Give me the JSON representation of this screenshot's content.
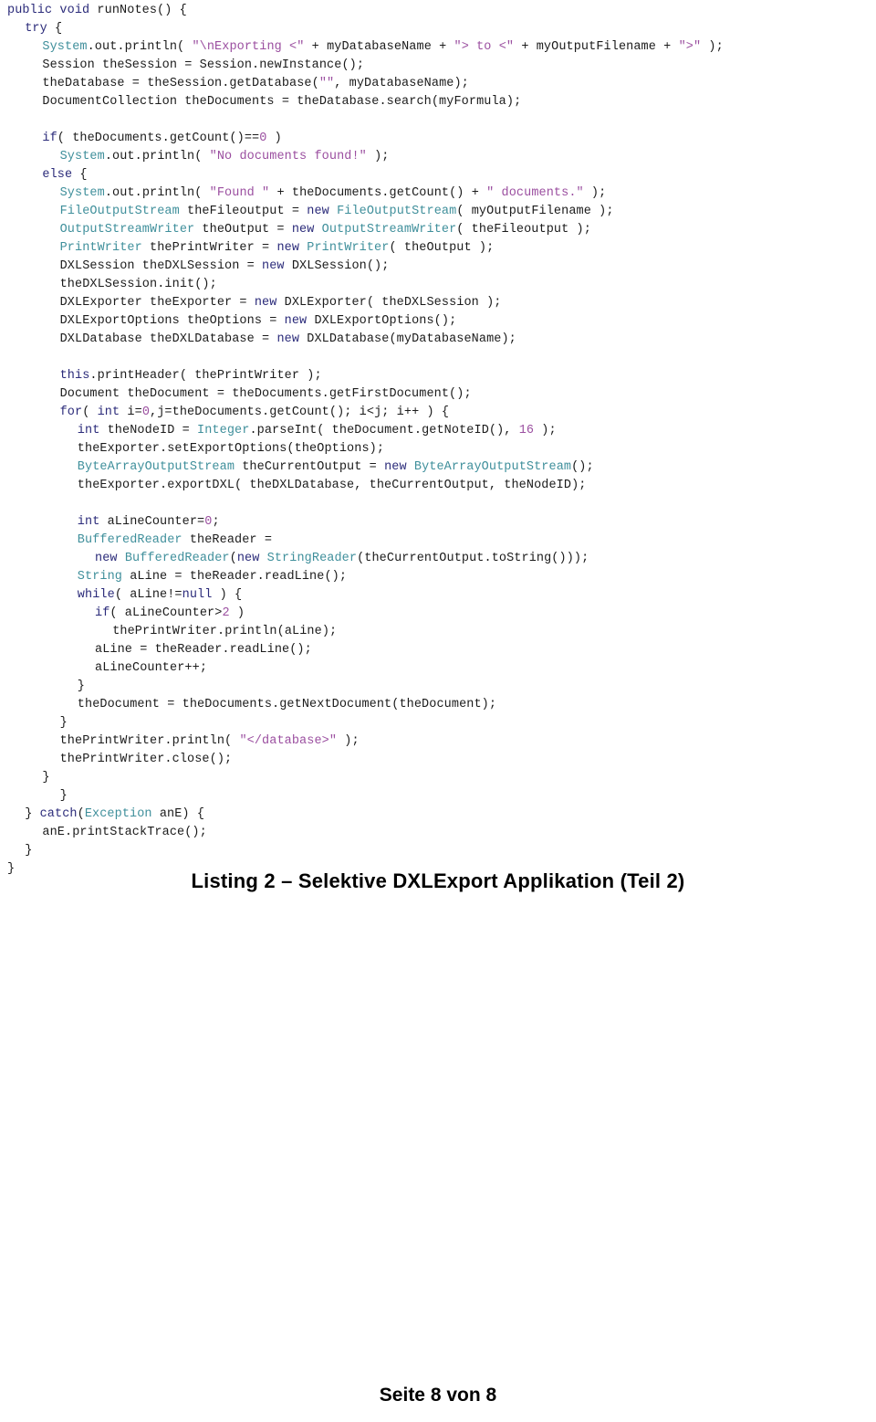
{
  "document": {
    "caption": "Listing 2 – Selektive DXLExport Applikation (Teil 2)",
    "footer": "Seite 8 von 8",
    "language": "java"
  },
  "code": {
    "lines": [
      {
        "indent": 0,
        "tokens": [
          {
            "t": "kw",
            "s": "public"
          },
          {
            "t": "plain",
            "s": " "
          },
          {
            "t": "kw",
            "s": "void"
          },
          {
            "t": "plain",
            "s": " runNotes() {"
          }
        ]
      },
      {
        "indent": 1,
        "tokens": [
          {
            "t": "kw",
            "s": "try"
          },
          {
            "t": "plain",
            "s": " {"
          }
        ]
      },
      {
        "indent": 2,
        "tokens": [
          {
            "t": "type",
            "s": "System"
          },
          {
            "t": "plain",
            "s": ".out.println( "
          },
          {
            "t": "str",
            "s": "\"\\nExporting <\""
          },
          {
            "t": "plain",
            "s": " + myDatabaseName + "
          },
          {
            "t": "str",
            "s": "\"> to <\""
          },
          {
            "t": "plain",
            "s": " + myOutputFilename + "
          },
          {
            "t": "str",
            "s": "\">\""
          },
          {
            "t": "plain",
            "s": " );"
          }
        ]
      },
      {
        "indent": 2,
        "tokens": [
          {
            "t": "plain",
            "s": "Session theSession = Session.newInstance();"
          }
        ]
      },
      {
        "indent": 2,
        "tokens": [
          {
            "t": "plain",
            "s": "theDatabase = theSession.getDatabase("
          },
          {
            "t": "str",
            "s": "\"\""
          },
          {
            "t": "plain",
            "s": ", myDatabaseName);"
          }
        ]
      },
      {
        "indent": 2,
        "tokens": [
          {
            "t": "plain",
            "s": "DocumentCollection theDocuments = theDatabase.search(myFormula);"
          }
        ]
      },
      {
        "indent": 0,
        "tokens": []
      },
      {
        "indent": 2,
        "tokens": [
          {
            "t": "kw",
            "s": "if"
          },
          {
            "t": "plain",
            "s": "( theDocuments.getCount()=="
          },
          {
            "t": "num",
            "s": "0"
          },
          {
            "t": "plain",
            "s": " )"
          }
        ]
      },
      {
        "indent": 3,
        "tokens": [
          {
            "t": "type",
            "s": "System"
          },
          {
            "t": "plain",
            "s": ".out.println( "
          },
          {
            "t": "str",
            "s": "\"No documents found!\""
          },
          {
            "t": "plain",
            "s": " );"
          }
        ]
      },
      {
        "indent": 2,
        "tokens": [
          {
            "t": "kw",
            "s": "else"
          },
          {
            "t": "plain",
            "s": " {"
          }
        ]
      },
      {
        "indent": 3,
        "tokens": [
          {
            "t": "type",
            "s": "System"
          },
          {
            "t": "plain",
            "s": ".out.println( "
          },
          {
            "t": "str",
            "s": "\"Found \""
          },
          {
            "t": "plain",
            "s": " + theDocuments.getCount() + "
          },
          {
            "t": "str",
            "s": "\" documents.\""
          },
          {
            "t": "plain",
            "s": " );"
          }
        ]
      },
      {
        "indent": 3,
        "tokens": [
          {
            "t": "type",
            "s": "FileOutputStream"
          },
          {
            "t": "plain",
            "s": " theFileoutput = "
          },
          {
            "t": "kw",
            "s": "new"
          },
          {
            "t": "plain",
            "s": " "
          },
          {
            "t": "type",
            "s": "FileOutputStream"
          },
          {
            "t": "plain",
            "s": "( myOutputFilename );"
          }
        ]
      },
      {
        "indent": 3,
        "tokens": [
          {
            "t": "type",
            "s": "OutputStreamWriter"
          },
          {
            "t": "plain",
            "s": " theOutput = "
          },
          {
            "t": "kw",
            "s": "new"
          },
          {
            "t": "plain",
            "s": " "
          },
          {
            "t": "type",
            "s": "OutputStreamWriter"
          },
          {
            "t": "plain",
            "s": "( theFileoutput );"
          }
        ]
      },
      {
        "indent": 3,
        "tokens": [
          {
            "t": "type",
            "s": "PrintWriter"
          },
          {
            "t": "plain",
            "s": " thePrintWriter = "
          },
          {
            "t": "kw",
            "s": "new"
          },
          {
            "t": "plain",
            "s": " "
          },
          {
            "t": "type",
            "s": "PrintWriter"
          },
          {
            "t": "plain",
            "s": "( theOutput );"
          }
        ]
      },
      {
        "indent": 3,
        "tokens": [
          {
            "t": "plain",
            "s": "DXLSession theDXLSession = "
          },
          {
            "t": "kw",
            "s": "new"
          },
          {
            "t": "plain",
            "s": " DXLSession();"
          }
        ]
      },
      {
        "indent": 3,
        "tokens": [
          {
            "t": "plain",
            "s": "theDXLSession.init();"
          }
        ]
      },
      {
        "indent": 3,
        "tokens": [
          {
            "t": "plain",
            "s": "DXLExporter theExporter = "
          },
          {
            "t": "kw",
            "s": "new"
          },
          {
            "t": "plain",
            "s": " DXLExporter( theDXLSession );"
          }
        ]
      },
      {
        "indent": 3,
        "tokens": [
          {
            "t": "plain",
            "s": "DXLExportOptions theOptions = "
          },
          {
            "t": "kw",
            "s": "new"
          },
          {
            "t": "plain",
            "s": " DXLExportOptions();"
          }
        ]
      },
      {
        "indent": 3,
        "tokens": [
          {
            "t": "plain",
            "s": "DXLDatabase theDXLDatabase = "
          },
          {
            "t": "kw",
            "s": "new"
          },
          {
            "t": "plain",
            "s": " DXLDatabase(myDatabaseName);"
          }
        ]
      },
      {
        "indent": 0,
        "tokens": []
      },
      {
        "indent": 3,
        "tokens": [
          {
            "t": "kw",
            "s": "this"
          },
          {
            "t": "plain",
            "s": ".printHeader( thePrintWriter );"
          }
        ]
      },
      {
        "indent": 3,
        "tokens": [
          {
            "t": "plain",
            "s": "Document theDocument = theDocuments.getFirstDocument();"
          }
        ]
      },
      {
        "indent": 3,
        "tokens": [
          {
            "t": "kw",
            "s": "for"
          },
          {
            "t": "plain",
            "s": "( "
          },
          {
            "t": "kw",
            "s": "int"
          },
          {
            "t": "plain",
            "s": " i="
          },
          {
            "t": "num",
            "s": "0"
          },
          {
            "t": "plain",
            "s": ",j=theDocuments.getCount(); i<j; i++ ) {"
          }
        ]
      },
      {
        "indent": 4,
        "tokens": [
          {
            "t": "kw",
            "s": "int"
          },
          {
            "t": "plain",
            "s": " theNodeID = "
          },
          {
            "t": "type",
            "s": "Integer"
          },
          {
            "t": "plain",
            "s": ".parseInt( theDocument.getNoteID(), "
          },
          {
            "t": "num",
            "s": "16"
          },
          {
            "t": "plain",
            "s": " );"
          }
        ]
      },
      {
        "indent": 4,
        "tokens": [
          {
            "t": "plain",
            "s": "theExporter.setExportOptions(theOptions);"
          }
        ]
      },
      {
        "indent": 4,
        "tokens": [
          {
            "t": "type",
            "s": "ByteArrayOutputStream"
          },
          {
            "t": "plain",
            "s": " theCurrentOutput = "
          },
          {
            "t": "kw",
            "s": "new"
          },
          {
            "t": "plain",
            "s": " "
          },
          {
            "t": "type",
            "s": "ByteArrayOutputStream"
          },
          {
            "t": "plain",
            "s": "();"
          }
        ]
      },
      {
        "indent": 4,
        "tokens": [
          {
            "t": "plain",
            "s": "theExporter.exportDXL( theDXLDatabase, theCurrentOutput, theNodeID);"
          }
        ]
      },
      {
        "indent": 0,
        "tokens": []
      },
      {
        "indent": 4,
        "tokens": [
          {
            "t": "kw",
            "s": "int"
          },
          {
            "t": "plain",
            "s": " aLineCounter="
          },
          {
            "t": "num",
            "s": "0"
          },
          {
            "t": "plain",
            "s": ";"
          }
        ]
      },
      {
        "indent": 4,
        "tokens": [
          {
            "t": "type",
            "s": "BufferedReader"
          },
          {
            "t": "plain",
            "s": " theReader ="
          }
        ]
      },
      {
        "indent": 5,
        "tokens": [
          {
            "t": "kw",
            "s": "new"
          },
          {
            "t": "plain",
            "s": " "
          },
          {
            "t": "type",
            "s": "BufferedReader"
          },
          {
            "t": "plain",
            "s": "("
          },
          {
            "t": "kw",
            "s": "new"
          },
          {
            "t": "plain",
            "s": " "
          },
          {
            "t": "type",
            "s": "StringReader"
          },
          {
            "t": "plain",
            "s": "(theCurrentOutput.toString()));"
          }
        ]
      },
      {
        "indent": 4,
        "tokens": [
          {
            "t": "type",
            "s": "String"
          },
          {
            "t": "plain",
            "s": " aLine = theReader.readLine();"
          }
        ]
      },
      {
        "indent": 4,
        "tokens": [
          {
            "t": "kw",
            "s": "while"
          },
          {
            "t": "plain",
            "s": "( aLine!="
          },
          {
            "t": "kw",
            "s": "null"
          },
          {
            "t": "plain",
            "s": " ) {"
          }
        ]
      },
      {
        "indent": 5,
        "tokens": [
          {
            "t": "kw",
            "s": "if"
          },
          {
            "t": "plain",
            "s": "( aLineCounter>"
          },
          {
            "t": "num",
            "s": "2"
          },
          {
            "t": "plain",
            "s": " )"
          }
        ]
      },
      {
        "indent": 6,
        "tokens": [
          {
            "t": "plain",
            "s": "thePrintWriter.println(aLine);"
          }
        ]
      },
      {
        "indent": 5,
        "tokens": [
          {
            "t": "plain",
            "s": "aLine = theReader.readLine();"
          }
        ]
      },
      {
        "indent": 5,
        "tokens": [
          {
            "t": "plain",
            "s": "aLineCounter++;"
          }
        ]
      },
      {
        "indent": 4,
        "tokens": [
          {
            "t": "plain",
            "s": "}"
          }
        ]
      },
      {
        "indent": 4,
        "tokens": [
          {
            "t": "plain",
            "s": "theDocument = theDocuments.getNextDocument(theDocument);"
          }
        ]
      },
      {
        "indent": 3,
        "tokens": [
          {
            "t": "plain",
            "s": "}"
          }
        ]
      },
      {
        "indent": 3,
        "tokens": [
          {
            "t": "plain",
            "s": "thePrintWriter.println( "
          },
          {
            "t": "str",
            "s": "\"</database>\""
          },
          {
            "t": "plain",
            "s": " );"
          }
        ]
      },
      {
        "indent": 3,
        "tokens": [
          {
            "t": "plain",
            "s": "thePrintWriter.close();"
          }
        ]
      },
      {
        "indent": 2,
        "tokens": [
          {
            "t": "plain",
            "s": "}"
          }
        ]
      },
      {
        "indent": 3,
        "tokens": [
          {
            "t": "plain",
            "s": "}"
          }
        ]
      },
      {
        "indent": 1,
        "tokens": [
          {
            "t": "plain",
            "s": "} "
          },
          {
            "t": "kw",
            "s": "catch"
          },
          {
            "t": "plain",
            "s": "("
          },
          {
            "t": "type",
            "s": "Exception"
          },
          {
            "t": "plain",
            "s": " anE) {"
          }
        ]
      },
      {
        "indent": 2,
        "tokens": [
          {
            "t": "plain",
            "s": "anE.printStackTrace();"
          }
        ]
      },
      {
        "indent": 1,
        "tokens": [
          {
            "t": "plain",
            "s": "}"
          }
        ]
      },
      {
        "indent": 0,
        "tokens": [
          {
            "t": "plain",
            "s": "}"
          }
        ]
      }
    ],
    "colors": {
      "plain": "#1b1b1b",
      "keyword": "#2b2b7a",
      "type": "#3f8f9b",
      "string": "#9b4fa0",
      "number": "#9b4fa0",
      "background": "#ffffff"
    }
  }
}
